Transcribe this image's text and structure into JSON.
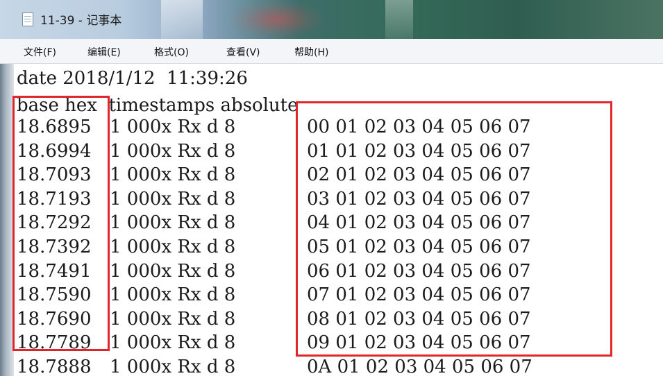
{
  "window": {
    "title": "11-39 - 记事本"
  },
  "menu": {
    "items": [
      "文件(F)",
      "编辑(E)",
      "格式(O)",
      "查看(V)",
      "帮助(H)"
    ]
  },
  "document": {
    "header_lines": [
      "date 2018/1/12  11:39:26",
      "base hex  timestamps absolute"
    ],
    "rows": [
      {
        "timestamp": "18.6895",
        "fields": "1 000x Rx d 8",
        "data": "00 01 02 03 04 05 06 07"
      },
      {
        "timestamp": "18.6994",
        "fields": "1 000x Rx d 8",
        "data": "01 01 02 03 04 05 06 07"
      },
      {
        "timestamp": "18.7093",
        "fields": "1 000x Rx d 8",
        "data": "02 01 02 03 04 05 06 07"
      },
      {
        "timestamp": "18.7193",
        "fields": "1 000x Rx d 8",
        "data": "03 01 02 03 04 05 06 07"
      },
      {
        "timestamp": "18.7292",
        "fields": "1 000x Rx d 8",
        "data": "04 01 02 03 04 05 06 07"
      },
      {
        "timestamp": "18.7392",
        "fields": "1 000x Rx d 8",
        "data": "05 01 02 03 04 05 06 07"
      },
      {
        "timestamp": "18.7491",
        "fields": "1 000x Rx d 8",
        "data": "06 01 02 03 04 05 06 07"
      },
      {
        "timestamp": "18.7590",
        "fields": "1 000x Rx d 8",
        "data": "07 01 02 03 04 05 06 07"
      },
      {
        "timestamp": "18.7690",
        "fields": "1 000x Rx d 8",
        "data": "08 01 02 03 04 05 06 07"
      },
      {
        "timestamp": "18.7789",
        "fields": "1 000x Rx d 8",
        "data": "09 01 02 03 04 05 06 07"
      },
      {
        "timestamp": "18.7888",
        "fields": "1 000x Rx d 8",
        "data": "0A 01 02 03 04 05 06 07"
      }
    ]
  },
  "highlight_color": "#e0262b",
  "icons": {
    "app_icon": "notepad-icon"
  }
}
